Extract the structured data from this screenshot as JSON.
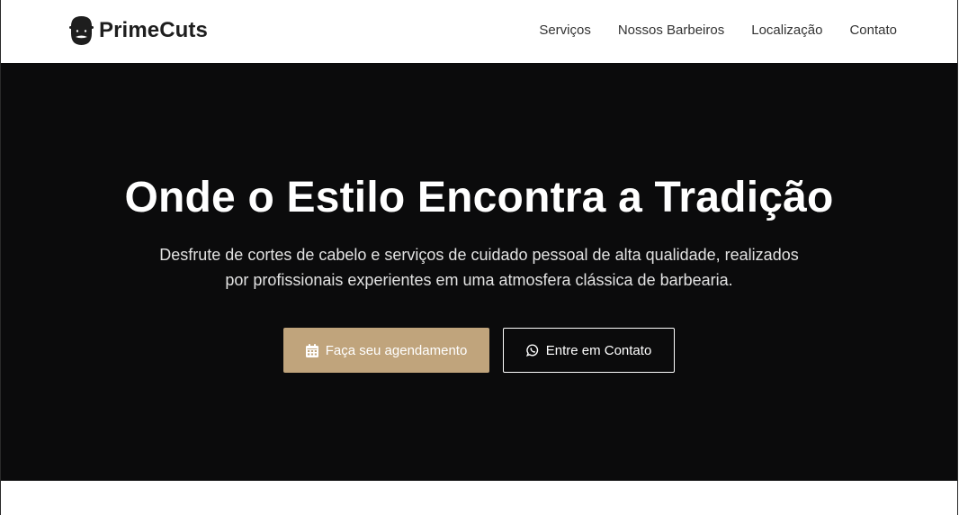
{
  "brand": {
    "name": "PrimeCuts",
    "icon": "bearded-man-icon"
  },
  "nav": {
    "links": [
      "Serviços",
      "Nossos Barbeiros",
      "Localização",
      "Contato"
    ]
  },
  "hero": {
    "title": "Onde o Estilo Encontra a Tradição",
    "subtitle_line1": "Desfrute de cortes de cabelo e serviços de cuidado pessoal de alta qualidade, realizados",
    "subtitle_line2": "por profissionais experientes em uma atmosfera clássica de barbearia.",
    "primary_button": {
      "label": "Faça seu agendamento",
      "icon": "calendar-icon"
    },
    "secondary_button": {
      "label": "Entre em Contato",
      "icon": "whatsapp-icon"
    }
  },
  "colors": {
    "hero_background": "#0b0b0c",
    "accent": "#c0a47c",
    "navbar_background": "#ffffff"
  }
}
